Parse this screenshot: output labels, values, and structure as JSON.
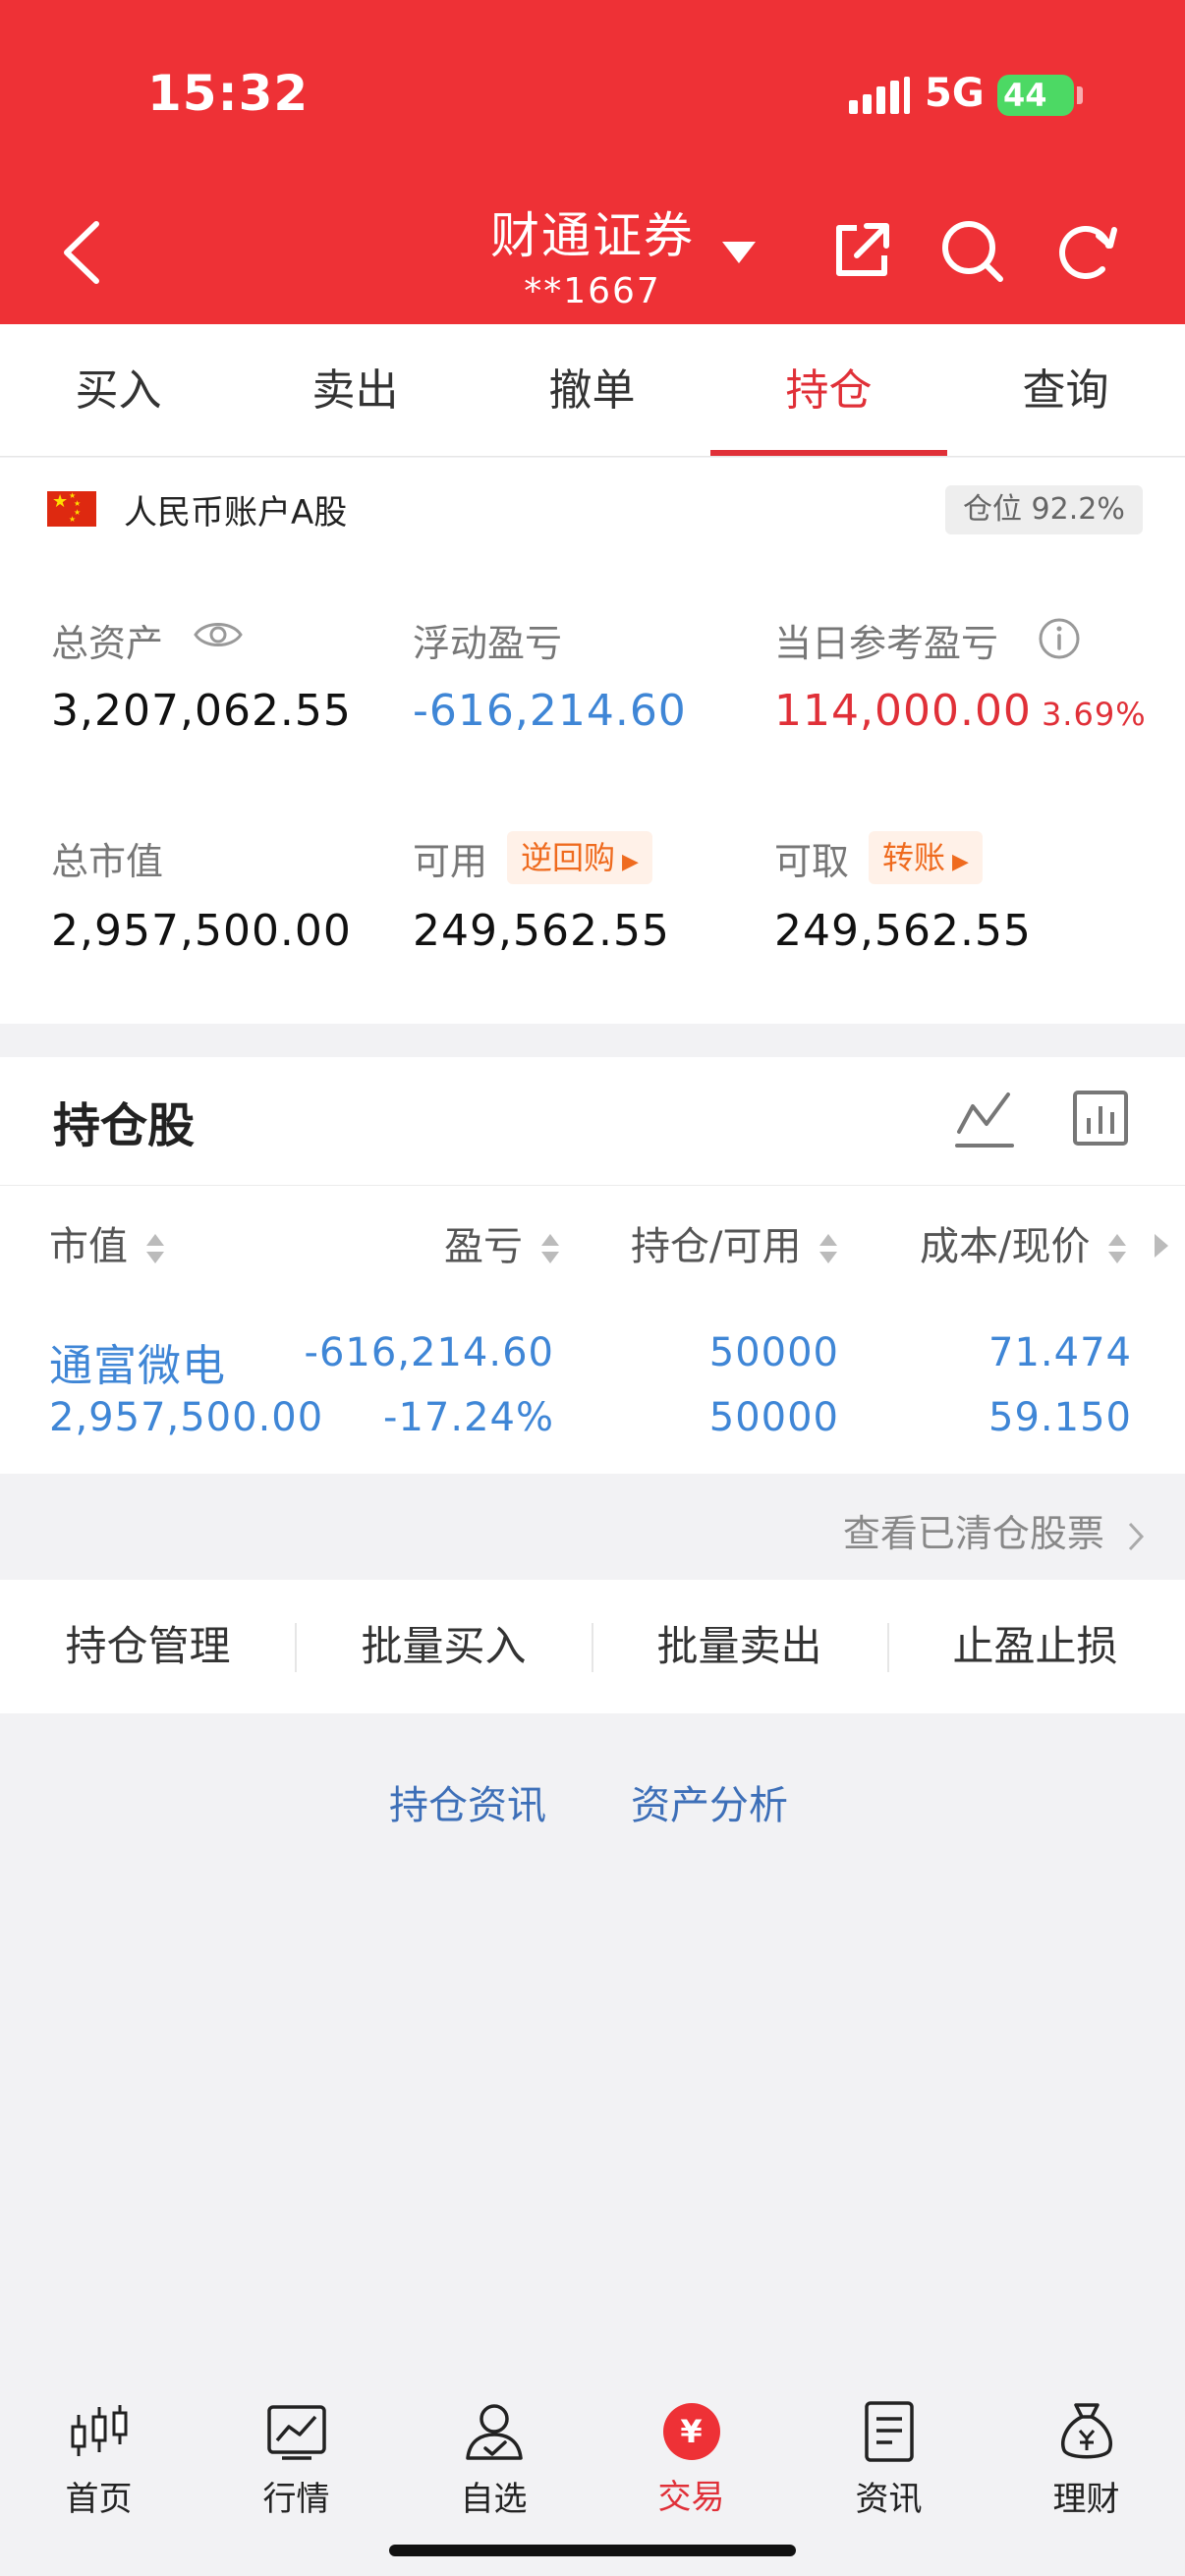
{
  "status_bar": {
    "time": "15:32",
    "network": "5G",
    "battery": "44"
  },
  "header": {
    "broker": "财通证券",
    "account": "**1667"
  },
  "tabs": [
    {
      "label": "买入"
    },
    {
      "label": "卖出"
    },
    {
      "label": "撤单"
    },
    {
      "label": "持仓",
      "active": true
    },
    {
      "label": "查询"
    }
  ],
  "account": {
    "label": "人民币账户A股",
    "position_ratio": "仓位 92.2%",
    "total_assets_label": "总资产",
    "total_assets": "3,207,062.55",
    "floating_pnl_label": "浮动盈亏",
    "floating_pnl": "-616,214.60",
    "daily_pnl_label": "当日参考盈亏",
    "daily_pnl": "114,000.00",
    "daily_pnl_pct": "3.69%",
    "market_value_label": "总市值",
    "market_value": "2,957,500.00",
    "available_label": "可用",
    "reverse_repo_tag": "逆回购",
    "available": "249,562.55",
    "withdrawable_label": "可取",
    "transfer_tag": "转账",
    "withdrawable": "249,562.55"
  },
  "holdings": {
    "title": "持仓股",
    "columns": [
      "市值",
      "盈亏",
      "持仓/可用",
      "成本/现价"
    ],
    "rows": [
      {
        "name": "通富微电",
        "market_value": "2,957,500.00",
        "pnl": "-616,214.60",
        "pnl_pct": "-17.24%",
        "holding": "50000",
        "available": "50000",
        "cost": "71.474",
        "price": "59.150"
      }
    ],
    "cleared_link": "查看已清仓股票"
  },
  "actions": [
    "持仓管理",
    "批量买入",
    "批量卖出",
    "止盈止损"
  ],
  "links": [
    "持仓资讯",
    "资产分析"
  ],
  "bottom_nav": [
    {
      "label": "首页",
      "icon": "candlestick-icon"
    },
    {
      "label": "行情",
      "icon": "market-chart-icon"
    },
    {
      "label": "自选",
      "icon": "user-check-icon"
    },
    {
      "label": "交易",
      "icon": "yen-icon",
      "active": true
    },
    {
      "label": "资讯",
      "icon": "news-icon"
    },
    {
      "label": "理财",
      "icon": "money-bag-icon"
    }
  ],
  "colors": {
    "brand_red": "#ee3136",
    "accent_blue": "#3f86d6",
    "tag_orange": "#ef6b1f"
  }
}
